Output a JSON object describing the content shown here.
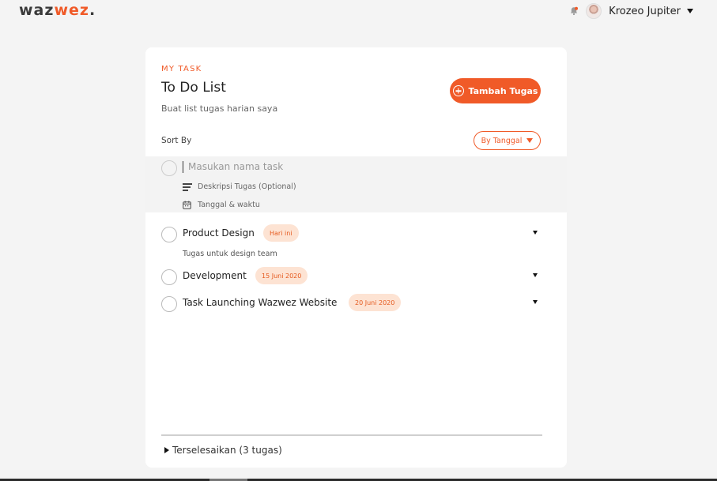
{
  "brand": {
    "part1": "waz",
    "part2": "wez",
    "dot": "."
  },
  "header": {
    "notification_icon": "bell-icon",
    "user_name": "Krozeo Jupiter",
    "menu_icon": "chevron-down-icon"
  },
  "colors": {
    "accent": "#f05a28",
    "badge_bg": "#fde3d3",
    "card_bg": "#ffffff",
    "page_bg": "#f4f4f4"
  },
  "card": {
    "eyebrow": "MY TASK",
    "title": "To Do List",
    "subtitle": "Buat list tugas harian saya",
    "add_button": "Tambah Tugas",
    "sort_label": "Sort By",
    "sort_value": "By Tanggal"
  },
  "new_task": {
    "name_placeholder": "Masukan nama task",
    "description_placeholder": "Deskripsi Tugas (Optional)",
    "datetime_placeholder": "Tanggal & waktu"
  },
  "tasks": [
    {
      "title": "Product Design",
      "badge": "Hari ini",
      "description": "Tugas untuk design team"
    },
    {
      "title": "Development",
      "badge": "15 Juni 2020",
      "description": ""
    },
    {
      "title": "Task Launching Wazwez Website",
      "badge": "20 Juni 2020",
      "description": ""
    }
  ],
  "completed": {
    "label": "Terselesaikan (3 tugas)"
  }
}
